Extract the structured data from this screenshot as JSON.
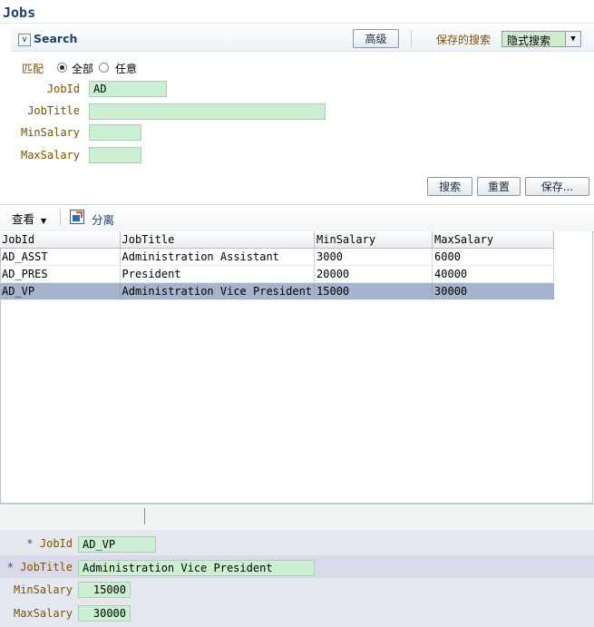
{
  "page": {
    "title": "Jobs"
  },
  "search": {
    "title": "Search",
    "advanced_label": "高级",
    "saved_search_label": "保存的搜索",
    "saved_search_value": "隐式搜索",
    "match_label": "匹配",
    "match_all_label": "全部",
    "match_any_label": "任意",
    "fields": {
      "jobid_label": "JobId",
      "jobid_value": "AD",
      "jobtitle_label": "JobTitle",
      "jobtitle_value": "",
      "minsalary_label": "MinSalary",
      "minsalary_value": "",
      "maxsalary_label": "MaxSalary",
      "maxsalary_value": ""
    },
    "search_button": "搜索",
    "reset_button": "重置",
    "save_button": "保存..."
  },
  "toolbar": {
    "view_label": "查看",
    "detach_label": "分离"
  },
  "table": {
    "columns": [
      "JobId",
      "JobTitle",
      "MinSalary",
      "MaxSalary"
    ],
    "rows": [
      {
        "jobid": "AD_ASST",
        "jobtitle": "Administration Assistant",
        "minsalary": "3000",
        "maxsalary": "6000"
      },
      {
        "jobid": "AD_PRES",
        "jobtitle": "President",
        "minsalary": "20000",
        "maxsalary": "40000"
      },
      {
        "jobid": "AD_VP",
        "jobtitle": "Administration Vice President",
        "minsalary": "15000",
        "maxsalary": "30000"
      }
    ],
    "selected_row": 2
  },
  "form": {
    "jobid_label": "JobId",
    "jobid_value": "AD_VP",
    "jobtitle_label": "JobTitle",
    "jobtitle_value": "Administration Vice President",
    "minsalary_label": "MinSalary",
    "minsalary_value": "15000",
    "maxsalary_label": "MaxSalary",
    "maxsalary_value": "30000",
    "required_marker": "*"
  }
}
